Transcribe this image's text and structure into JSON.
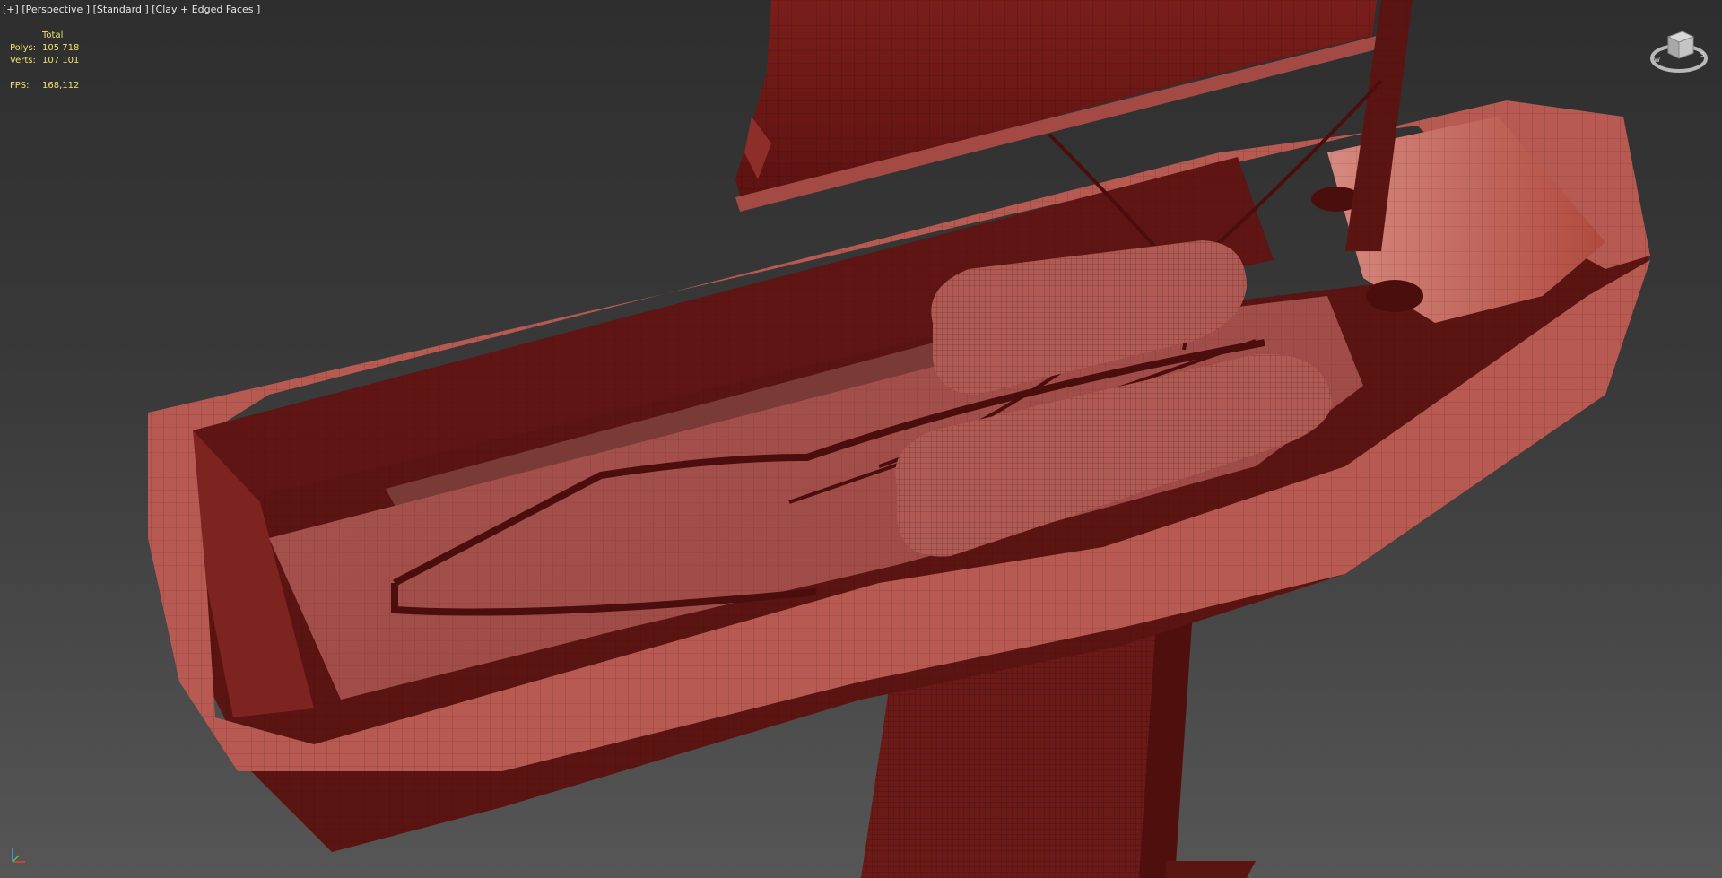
{
  "viewport": {
    "label_parts": [
      "[+]",
      "[Perspective ]",
      "[Standard ]",
      "[Clay + Edged Faces ]"
    ]
  },
  "stats": {
    "header": "Total",
    "polys_label": "Polys:",
    "polys_value": "105 718",
    "verts_label": "Verts:",
    "verts_value": "107 101",
    "fps_label": "FPS:",
    "fps_value": "168,112"
  },
  "icons": {
    "viewcube": "viewcube-icon",
    "axis": "axis-tripod-icon"
  },
  "colors": {
    "clay_base": "#9e4a45",
    "clay_dark": "#5a1412",
    "clay_light": "#c06a62",
    "stats_text": "#f0e070",
    "label_text": "#e6e6e6"
  }
}
